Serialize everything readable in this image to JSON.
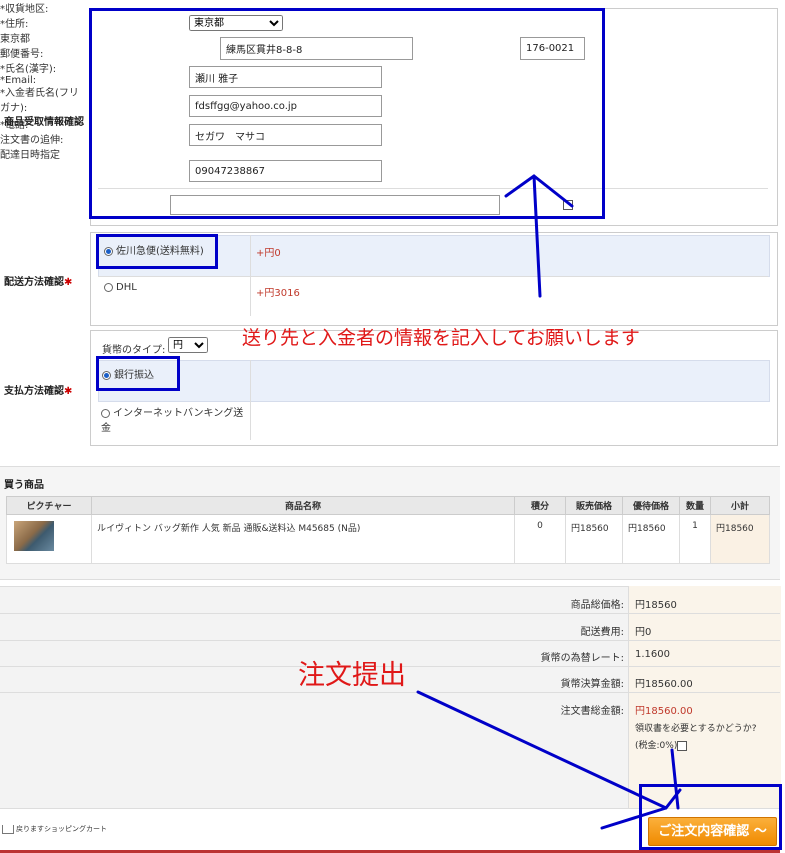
{
  "receiver": {
    "section_title": "商品受取情報確認",
    "region_label": "*収貨地区:",
    "region_value": "東京都",
    "address_label": "*住所:",
    "address_prefix": "東京都",
    "address_value": "練馬区貫井8-8-8",
    "postal_label": "郵便番号:",
    "postal_value": "176-0021",
    "name_label": "*氏名(漢字):",
    "name_value": "瀬川 雅子",
    "email_label": "*Email:",
    "email_value": "fdsffgg@yahoo.co.jp",
    "payer_label_1": "*入金者氏名(フリ",
    "payer_label_2": "ガナ):",
    "payer_value": "セガワ　マサコ",
    "phone_label": "*電話:",
    "phone_value": "09047238867",
    "note_label": "注文書の追伸:",
    "note_value": "",
    "delivery_date_label": "配達日時指定"
  },
  "shipping": {
    "section_title": "配送方法確認",
    "options": [
      {
        "label": "佐川急便(送料無料)",
        "price": "+円0",
        "selected": true
      },
      {
        "label": "DHL",
        "price": "+円3016",
        "selected": false
      }
    ]
  },
  "payment": {
    "section_title": "支払方法確認",
    "currency_label": "貨幣のタイプ:",
    "currency_value": "円",
    "options": [
      {
        "label": "銀行振込",
        "selected": true
      },
      {
        "label_1": "インターネットバンキング送",
        "label_2": "金",
        "selected": false
      }
    ]
  },
  "goods": {
    "section_title": "買う商品",
    "headers": [
      "ピクチャー",
      "商品名称",
      "積分",
      "販売価格",
      "優待価格",
      "数量",
      "小計"
    ],
    "rows": [
      {
        "name": "ルイヴィトン バッグ新作 人気 新品 通販&送料込 M45685 (N品)",
        "points": "0",
        "sale_price": "円18560",
        "special_price": "円18560",
        "qty": "1",
        "subtotal": "円18560"
      }
    ]
  },
  "summary": {
    "total_goods_label": "商品総価格:",
    "total_goods_value": "円18560",
    "shipping_label": "配送費用:",
    "shipping_value": "円0",
    "rate_label": "貨幣の為替レート:",
    "rate_value": "1.1600",
    "settle_label": "貨幣決算金額:",
    "settle_value": "円18560.00",
    "order_total_label": "注文書総金額:",
    "order_total_value": "円18560.00",
    "receipt_question": "領収書を必要とするかどうか?",
    "tax_label": "(税金:0%)"
  },
  "footer": {
    "back_label": "戻りますショッピングカート",
    "confirm_label": "ご注文内容確認 〜"
  },
  "annotations": {
    "info_note": "送り先と入金者の情報を記入してお願いします",
    "submit_note": "注文提出"
  },
  "colors": {
    "annotation_blue": "#0000c8",
    "annotation_red": "#e01818",
    "confirm_button": "#f08a00",
    "price_red": "#c0392b"
  }
}
